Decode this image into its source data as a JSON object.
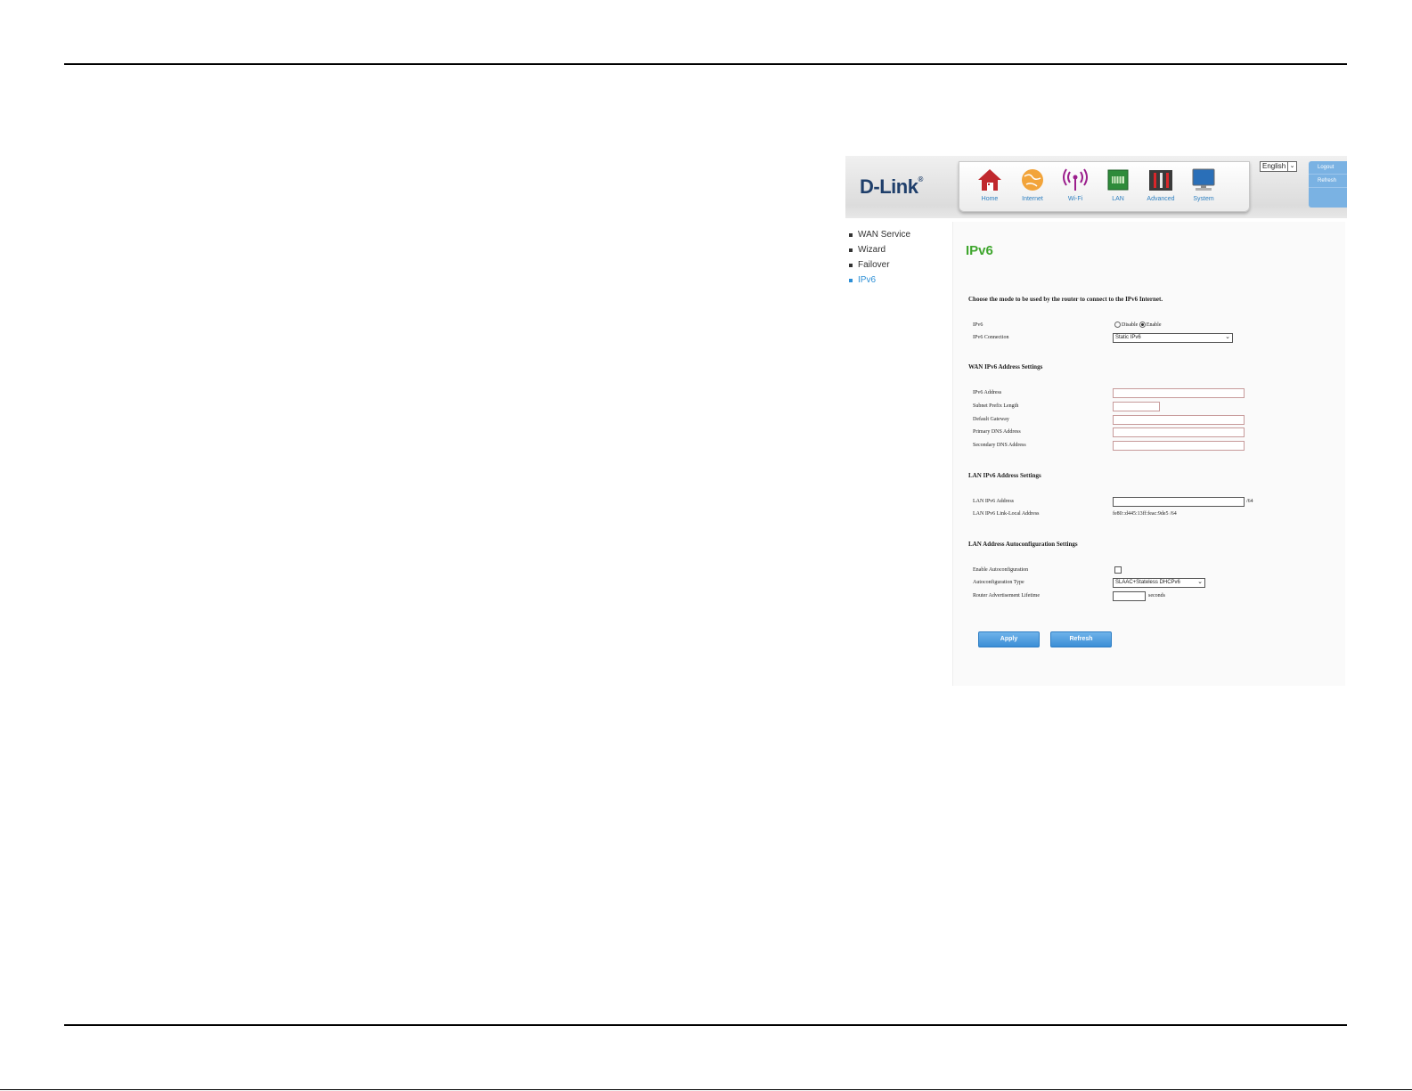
{
  "brand": {
    "logo": "D-Link",
    "reg_mark": "®"
  },
  "language": {
    "selected": "English",
    "dropdown_glyph": "⌄"
  },
  "side_buttons": [
    "Logout",
    "Refresh"
  ],
  "nav": [
    {
      "label": "Home",
      "icon": "home-icon"
    },
    {
      "label": "Internet",
      "icon": "globe-icon"
    },
    {
      "label": "Wi-Fi",
      "icon": "wifi-icon"
    },
    {
      "label": "LAN",
      "icon": "lan-icon"
    },
    {
      "label": "Advanced",
      "icon": "tools-icon"
    },
    {
      "label": "System",
      "icon": "monitor-icon"
    }
  ],
  "subnav": [
    "WAN Service",
    "Wizard",
    "Failover",
    "IPv6"
  ],
  "page": {
    "title": "IPv6",
    "intro": "Choose the mode to be used by the router to connect to the IPv6 Internet.",
    "ipv6": {
      "label": "IPv6",
      "disable": "Disable",
      "enable": "Enable"
    },
    "connection": {
      "label": "IPv6 Connection",
      "value": "Static IPv6",
      "chevron": "⌄"
    },
    "wan_section": {
      "title": "WAN IPv6 Address Settings",
      "fields": [
        "IPv6 Address",
        "Subnet Prefix Length",
        "Default Gateway",
        "Primary DNS Address",
        "Secondary DNS Address"
      ]
    },
    "lan_section": {
      "title": "LAN IPv6 Address Settings",
      "address_label": "LAN IPv6 Address",
      "address_suffix": "/64",
      "link_local_label": "LAN IPv6 Link-Local Address",
      "link_local_value": "fe80::d445:13ff:feac:9de5 /64"
    },
    "auto_section": {
      "title": "LAN Address Autoconfiguration Settings",
      "enable_label": "Enable Autoconfiguration",
      "type_label": "Autoconfiguration Type",
      "type_value": "SLAAC+Stateless DHCPv6",
      "type_chevron": "⌄",
      "lifetime_label": "Router Advertisement Lifetime",
      "lifetime_unit": "seconds"
    },
    "buttons": {
      "apply": "Apply",
      "refresh": "Refresh"
    }
  }
}
